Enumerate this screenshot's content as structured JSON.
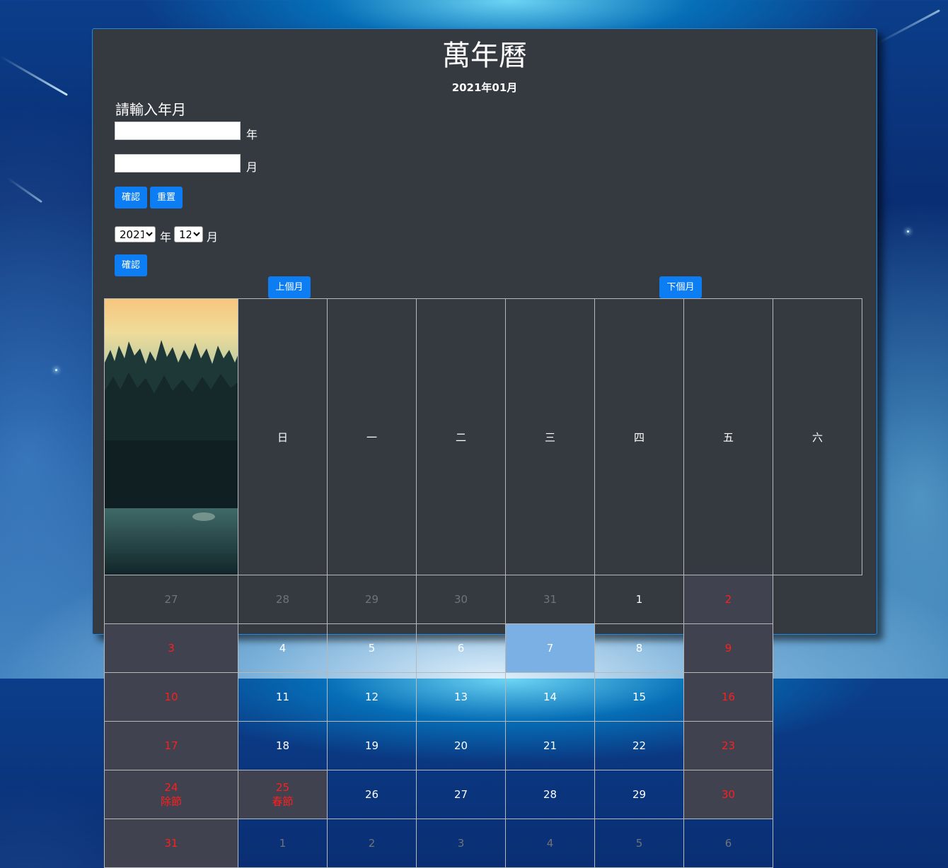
{
  "header": {
    "title": "萬年曆",
    "current": "2021年01月"
  },
  "form": {
    "label": "請輸入年月",
    "year_value": "",
    "year_unit": "年",
    "month_value": "",
    "month_unit": "月",
    "confirm_label": "確認",
    "reset_label": "重置"
  },
  "picker": {
    "year_selected": "2021",
    "year_unit": "年",
    "month_selected": "12",
    "month_unit": "月",
    "confirm_label": "確認"
  },
  "nav": {
    "prev_label": "上個月",
    "next_label": "下個月"
  },
  "calendar": {
    "weekdays": [
      "日",
      "一",
      "二",
      "三",
      "四",
      "五",
      "六"
    ],
    "weeks": [
      [
        {
          "d": "27",
          "t": "other"
        },
        {
          "d": "28",
          "t": "other"
        },
        {
          "d": "29",
          "t": "other"
        },
        {
          "d": "30",
          "t": "other"
        },
        {
          "d": "31",
          "t": "other"
        },
        {
          "d": "1",
          "t": "normal"
        },
        {
          "d": "2",
          "t": "weekend"
        }
      ],
      [
        {
          "d": "3",
          "t": "weekend"
        },
        {
          "d": "4",
          "t": "normal"
        },
        {
          "d": "5",
          "t": "normal"
        },
        {
          "d": "6",
          "t": "normal"
        },
        {
          "d": "7",
          "t": "today"
        },
        {
          "d": "8",
          "t": "normal"
        },
        {
          "d": "9",
          "t": "weekend"
        }
      ],
      [
        {
          "d": "10",
          "t": "weekend"
        },
        {
          "d": "11",
          "t": "normal"
        },
        {
          "d": "12",
          "t": "normal"
        },
        {
          "d": "13",
          "t": "normal"
        },
        {
          "d": "14",
          "t": "normal"
        },
        {
          "d": "15",
          "t": "normal"
        },
        {
          "d": "16",
          "t": "weekend"
        }
      ],
      [
        {
          "d": "17",
          "t": "weekend"
        },
        {
          "d": "18",
          "t": "normal"
        },
        {
          "d": "19",
          "t": "normal"
        },
        {
          "d": "20",
          "t": "normal"
        },
        {
          "d": "21",
          "t": "normal"
        },
        {
          "d": "22",
          "t": "normal"
        },
        {
          "d": "23",
          "t": "weekend"
        }
      ],
      [
        {
          "d": "24",
          "t": "weekend",
          "h": "除節"
        },
        {
          "d": "25",
          "t": "weekend",
          "h": "春節"
        },
        {
          "d": "26",
          "t": "normal"
        },
        {
          "d": "27",
          "t": "normal"
        },
        {
          "d": "28",
          "t": "normal"
        },
        {
          "d": "29",
          "t": "normal"
        },
        {
          "d": "30",
          "t": "weekend"
        }
      ],
      [
        {
          "d": "31",
          "t": "weekend"
        },
        {
          "d": "1",
          "t": "other"
        },
        {
          "d": "2",
          "t": "other"
        },
        {
          "d": "3",
          "t": "other"
        },
        {
          "d": "4",
          "t": "other"
        },
        {
          "d": "5",
          "t": "other"
        },
        {
          "d": "6",
          "t": "other"
        }
      ]
    ]
  },
  "colors": {
    "panel": "#343a40",
    "accent": "#0d7df3",
    "weekend_text": "#ff1e1e",
    "today_bg": "#7ab0e3"
  }
}
